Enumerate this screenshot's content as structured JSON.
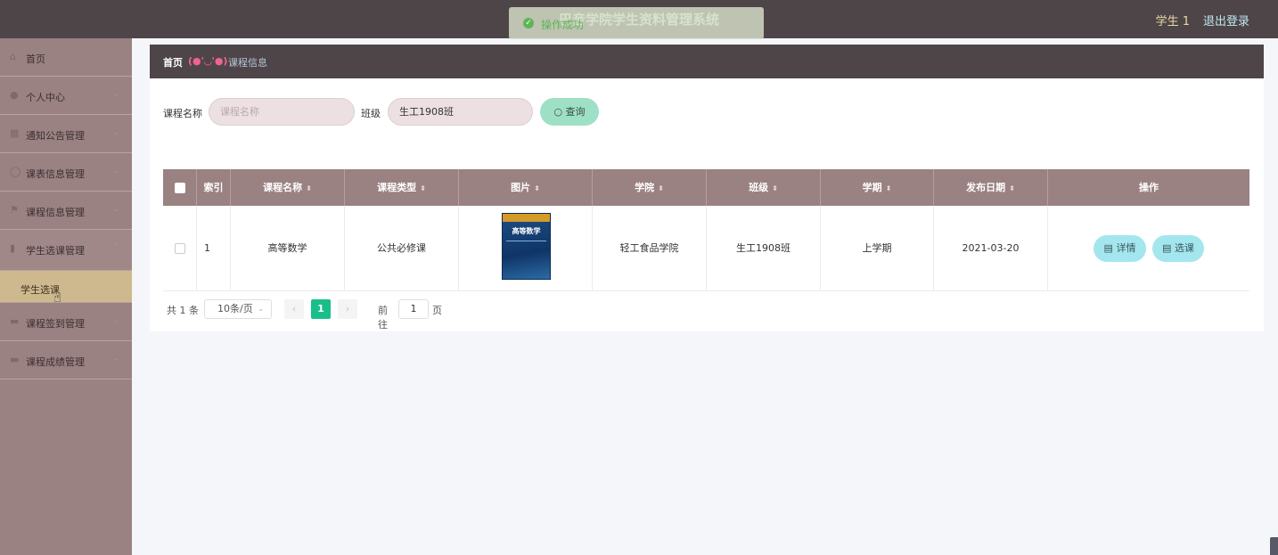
{
  "header": {
    "title": "巴音学院学生资料管理系统",
    "user": "学生 1",
    "logout": "退出登录",
    "toast": "操作成功"
  },
  "sidebar": {
    "items": [
      {
        "label": "首页"
      },
      {
        "label": "个人中心"
      },
      {
        "label": "通知公告管理"
      },
      {
        "label": "课表信息管理"
      },
      {
        "label": "课程信息管理"
      },
      {
        "label": "学生选课管理"
      },
      {
        "label": "课程签到管理"
      },
      {
        "label": "课程成绩管理"
      }
    ],
    "subitem": "学生选课"
  },
  "breadcrumb": {
    "home": "首页",
    "separator": "(●'◡'●)",
    "current": "课程信息"
  },
  "search": {
    "course_label": "课程名称",
    "course_placeholder": "课程名称",
    "class_label": "班级",
    "class_value": "生工1908班",
    "button": "查询"
  },
  "table": {
    "headers": [
      "索引",
      "课程名称",
      "课程类型",
      "图片",
      "学院",
      "班级",
      "学期",
      "发布日期",
      "操作"
    ],
    "rows": [
      {
        "index": "1",
        "name": "高等数学",
        "type": "公共必修课",
        "image_title": "高等数学",
        "college": "轻工食品学院",
        "class": "生工1908班",
        "term": "上学期",
        "date": "2021-03-20",
        "detail": "详情",
        "select": "选课"
      }
    ]
  },
  "pagination": {
    "total": "共 1 条",
    "page_size": "10条/页",
    "current_page": "1",
    "goto": "前往",
    "goto_value": "1",
    "unit": "页"
  },
  "colors": {
    "topbar": "#4e4548",
    "sidebar": "#9a8182",
    "active_submenu": "#cdb98d",
    "query_button": "#9ee0c6",
    "action_button": "#a4e6ee",
    "page_active": "#19be8b"
  }
}
